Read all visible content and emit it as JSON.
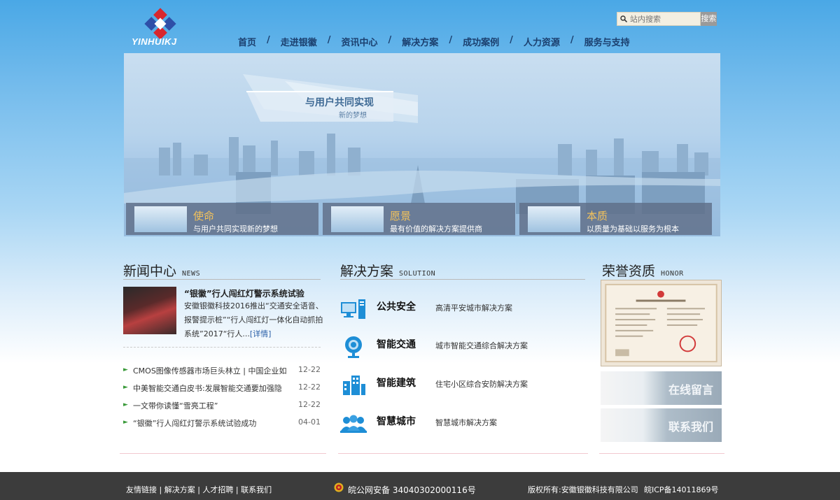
{
  "header": {
    "logo_text": "YINHUIKJ",
    "search_placeholder": "站内搜索",
    "search_button": "搜索",
    "nav": [
      "首页",
      "走进银徽",
      "资讯中心",
      "解决方案",
      "成功案例",
      "人力资源",
      "服务与支持"
    ],
    "nav_separator": "/"
  },
  "banner": {
    "slogan": "与用户共同实现",
    "slogan_sub": "新的梦想",
    "cards": [
      {
        "title": "使命",
        "subtitle": "与用户共同实现新的梦想"
      },
      {
        "title": "愿景",
        "subtitle": "最有价值的解决方案提供商"
      },
      {
        "title": "本质",
        "subtitle": "以质量为基础以服务为根本"
      }
    ]
  },
  "news": {
    "title": "新闻中心",
    "title_en": "NEWS",
    "featured_title": "“银徽”行人闯红灯警示系统试验",
    "featured_text": "安徽银徽科技2016推出“交通安全语音、报警提示桩”“行人闯红灯一体化自动抓拍系统”2017“行人...",
    "more": "[详情]",
    "items": [
      {
        "title": "CMOS图像传感器市场巨头林立 | 中国企业如",
        "date": "12-22"
      },
      {
        "title": "中美智能交通白皮书:发展智能交通要加强隐",
        "date": "12-22"
      },
      {
        "title": "一文带你读懂“雪亮工程”",
        "date": "12-22"
      },
      {
        "title": "“银徽”行人闯红灯警示系统试验成功",
        "date": "04-01"
      }
    ]
  },
  "solution": {
    "title": "解决方案",
    "title_en": "SOLUTION",
    "items": [
      {
        "name": "公共安全",
        "desc": "高清平安城市解决方案",
        "icon": "server-icon"
      },
      {
        "name": "智能交通",
        "desc": "城市智能交通综合解决方案",
        "icon": "camera-icon"
      },
      {
        "name": "智能建筑",
        "desc": "住宅小区综合安防解决方案",
        "icon": "building-icon"
      },
      {
        "name": "智慧城市",
        "desc": "智慧城市解决方案",
        "icon": "people-icon"
      }
    ]
  },
  "honor": {
    "title": "荣誉资质",
    "title_en": "HONOR",
    "buttons": [
      "在线留言",
      "联系我们"
    ]
  },
  "footer": {
    "links": [
      "友情链接",
      "解决方案",
      "人才招聘",
      "联系我们"
    ],
    "police": "皖公网安备 34040302000116号",
    "copyright": "版权所有:安徽银徽科技有限公司",
    "icp": "皖ICP备14011869号"
  },
  "colors": {
    "accent_blue": "#1e8ed6",
    "nav_text": "#1b3f6e",
    "card_title": "#f3c25b",
    "footer_bg": "#3c3c3c"
  }
}
